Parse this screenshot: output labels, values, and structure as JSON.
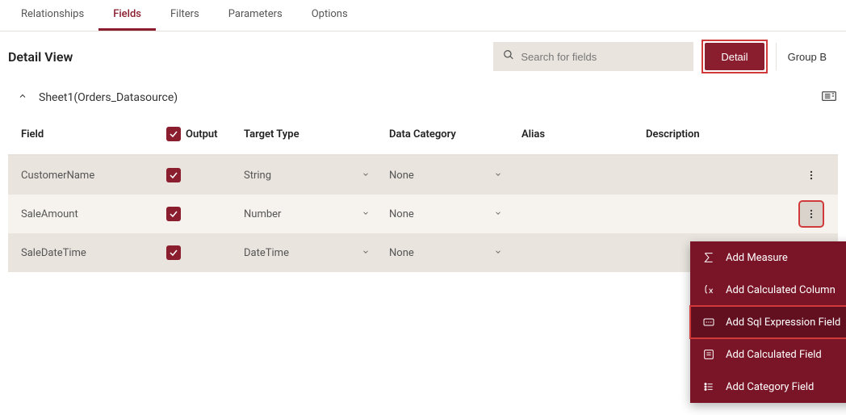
{
  "tabs": [
    "Relationships",
    "Fields",
    "Filters",
    "Parameters",
    "Options"
  ],
  "active_tab": "Fields",
  "page_title": "Detail View",
  "search": {
    "placeholder": "Search for fields"
  },
  "btn_detail": "Detail",
  "btn_group": "Group B",
  "sheet_title": "Sheet1(Orders_Datasource)",
  "columns": {
    "field": "Field",
    "output": "Output",
    "target": "Target Type",
    "category": "Data Category",
    "alias": "Alias",
    "desc": "Description"
  },
  "rows": [
    {
      "field": "CustomerName",
      "checked": true,
      "target": "String",
      "category": "None",
      "alias": "",
      "desc": ""
    },
    {
      "field": "SaleAmount",
      "checked": true,
      "target": "Number",
      "category": "None",
      "alias": "",
      "desc": ""
    },
    {
      "field": "SaleDateTime",
      "checked": true,
      "target": "DateTime",
      "category": "None",
      "alias": "",
      "desc": ""
    }
  ],
  "menu": {
    "items": [
      "Add Measure",
      "Add Calculated Column",
      "Add Sql Expression Field",
      "Add Calculated Field",
      "Add Category Field"
    ],
    "selected_index": 2
  }
}
